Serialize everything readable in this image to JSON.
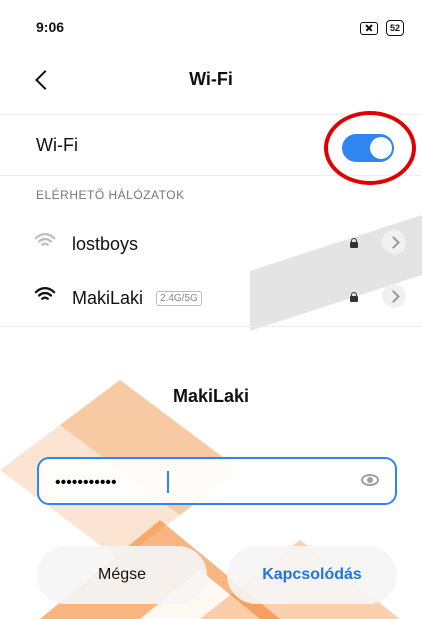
{
  "status_bar": {
    "time": "9:06",
    "battery": "52",
    "icons": [
      "sim-off-icon",
      "battery-icon"
    ]
  },
  "header": {
    "title": "Wi-Fi",
    "back_icon": "back-chevron-icon"
  },
  "wifi_toggle": {
    "label": "Wi-Fi",
    "state": "on",
    "accent_color": "#2f86f1",
    "highlight_color": "#e00000"
  },
  "available_networks": {
    "section_title": "ELÉRHETŐ HÁLÓZATOK",
    "items": [
      {
        "name": "lostboys",
        "badge": "",
        "secured": true,
        "icon": "wifi-icon"
      },
      {
        "name": "MakiLaki",
        "badge": "2.4G/5G",
        "secured": true,
        "icon": "wifi-icon"
      }
    ]
  },
  "dialog": {
    "title": "MakiLaki",
    "password_value": "•••••••••••",
    "buttons": {
      "cancel": "Mégse",
      "connect": "Kapcsolódás"
    }
  }
}
